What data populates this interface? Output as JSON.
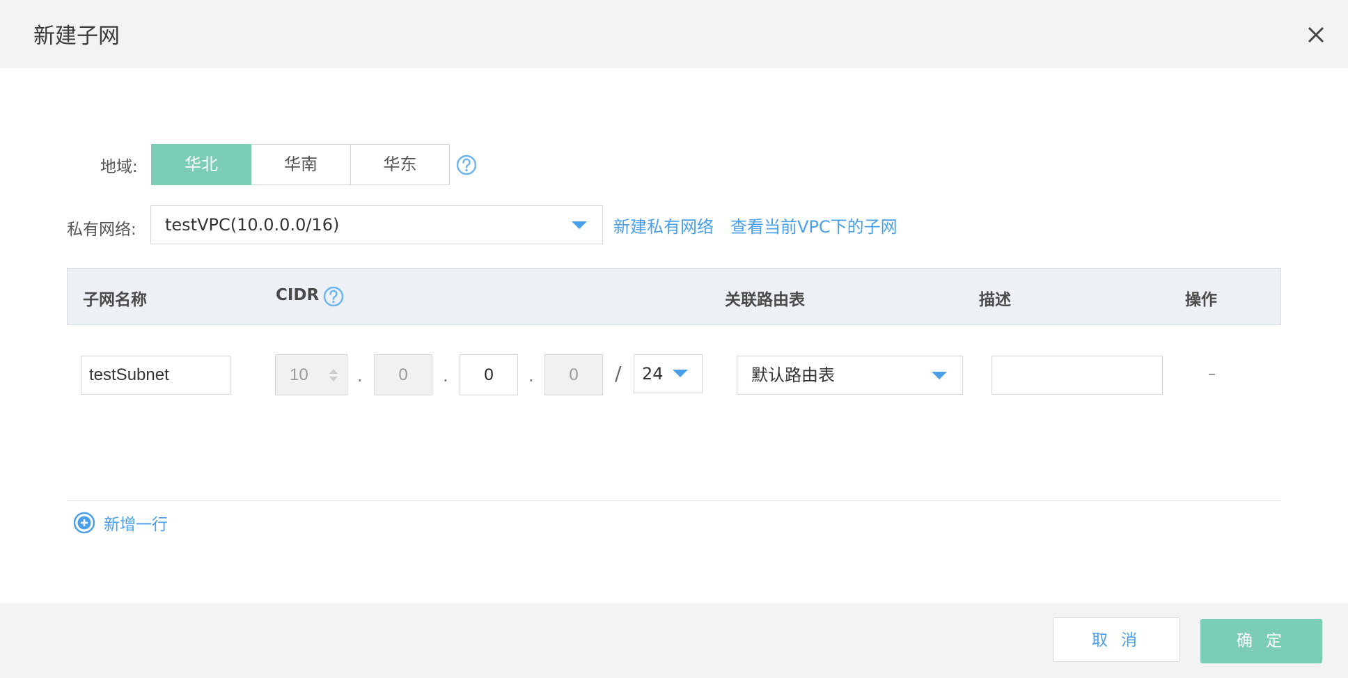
{
  "dialog": {
    "title": "新建子网"
  },
  "form": {
    "region_label": "地域:",
    "regions": [
      {
        "label": "华北",
        "active": true
      },
      {
        "label": "华南",
        "active": false
      },
      {
        "label": "华东",
        "active": false
      }
    ],
    "vpc_label": "私有网络:",
    "vpc_value": "testVPC(10.0.0.0/16)",
    "vpc_links": [
      "新建私有网络",
      "查看当前VPC下的子网"
    ]
  },
  "table": {
    "headers": [
      "子网名称",
      "CIDR",
      "关联路由表",
      "描述",
      "操作"
    ],
    "row": {
      "name": "testSubnet",
      "cidr": [
        "10",
        "0",
        "0",
        "0"
      ],
      "separator": ".",
      "slash": "/",
      "mask": "24",
      "route_table": "默认路由表",
      "description": "",
      "action": "–"
    }
  },
  "add_row_label": "新增一行",
  "footer": {
    "cancel": "取 消",
    "confirm": "确 定"
  },
  "colors": {
    "accent_green": "#7ccdb5",
    "link_blue": "#4a9fe8"
  },
  "icons": [
    "close-icon",
    "help-icon",
    "chevron-down-icon",
    "plus-circle-icon",
    "spinner-arrows-icon"
  ]
}
